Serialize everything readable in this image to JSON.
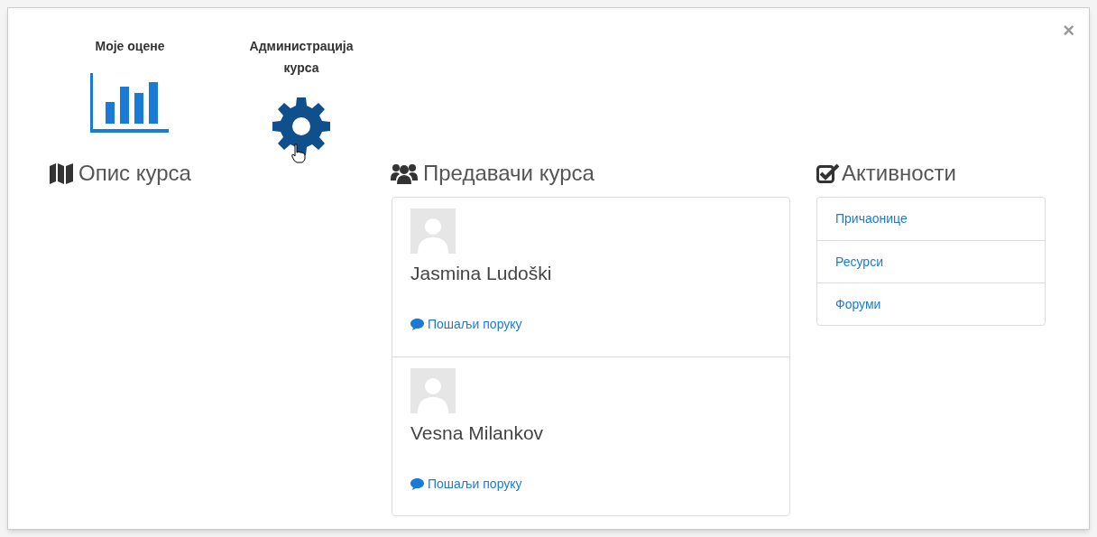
{
  "close": "×",
  "tiles": [
    {
      "kind": "chart",
      "label": "Моје оцене"
    },
    {
      "kind": "gear",
      "label": "Администрација курса"
    }
  ],
  "description": {
    "title": "Опис курса"
  },
  "teachers": {
    "title": "Предавачи курса",
    "items": [
      {
        "name": "Jasmina Ludoški",
        "message_link": "Пошаљи поруку"
      },
      {
        "name": "Vesna Milankov",
        "message_link": "Пошаљи поруку"
      }
    ]
  },
  "activities": {
    "title": "Активности",
    "items": [
      "Причаонице",
      "Ресурси",
      "Форуми"
    ]
  }
}
